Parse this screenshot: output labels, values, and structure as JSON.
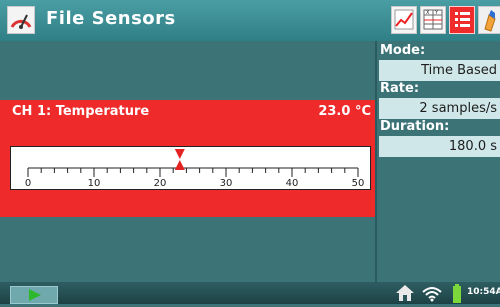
{
  "header": {
    "title": "File  Sensors"
  },
  "meter": {
    "channel_name": "CH 1: Temperature",
    "value_text": "23.0 °C",
    "value": 23.0,
    "scale_min": 0,
    "scale_max": 50,
    "tick_labels": [
      "0",
      "10",
      "20",
      "30",
      "40",
      "50"
    ]
  },
  "info": {
    "mode_label": "Mode:",
    "mode_value": "Time Based",
    "rate_label": "Rate:",
    "rate_value": "2 samples/s",
    "duration_label": "Duration:",
    "duration_value": "180.0 s"
  },
  "status": {
    "time": "10:54A"
  },
  "colors": {
    "header": "#2f7f86",
    "panel": "#3c7377",
    "channel_band": "#ee2a2a",
    "info_box": "#cfe7e8"
  },
  "icons": [
    "gauge-icon",
    "graph-view-icon",
    "table-view-icon",
    "meter-view-icon",
    "notes-icon",
    "play-icon",
    "home-icon",
    "wifi-icon",
    "battery-icon"
  ]
}
